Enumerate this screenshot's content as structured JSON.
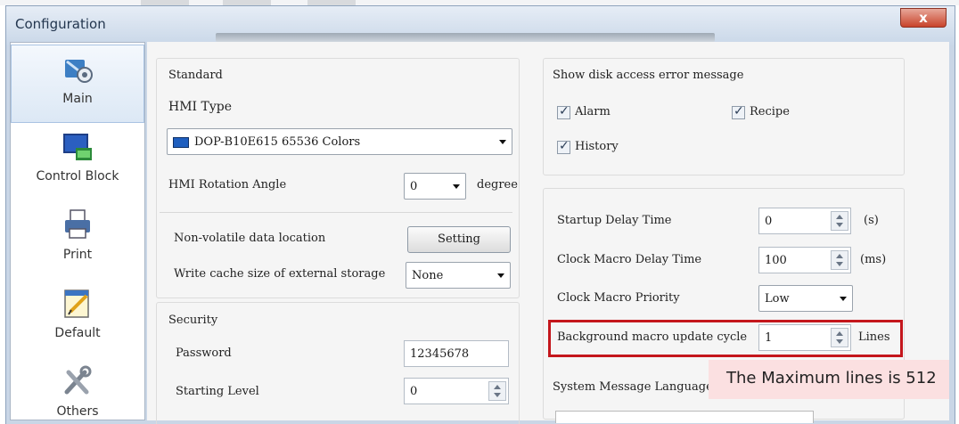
{
  "window": {
    "title": "Configuration",
    "close_label": "x"
  },
  "sidebar": {
    "items": [
      {
        "label": "Main",
        "icon": "main-config-icon",
        "selected": true
      },
      {
        "label": "Control Block",
        "icon": "control-block-icon",
        "selected": false
      },
      {
        "label": "Print",
        "icon": "printer-icon",
        "selected": false
      },
      {
        "label": "Default",
        "icon": "default-notepad-icon",
        "selected": false
      },
      {
        "label": "Others",
        "icon": "tools-icon",
        "selected": false
      }
    ]
  },
  "standard": {
    "title": "Standard",
    "hmi_type_label": "HMI Type",
    "hmi_type_value": "DOP-B10E615 65536 Colors",
    "rotation_label": "HMI Rotation Angle",
    "rotation_value": "0",
    "rotation_unit": "degree",
    "nonvolatile_label": "Non-volatile data location",
    "setting_button": "Setting",
    "write_cache_label": "Write cache size of external storage",
    "write_cache_value": "None"
  },
  "security": {
    "title": "Security",
    "password_label": "Password",
    "password_value": "12345678",
    "starting_level_label": "Starting Level",
    "starting_level_value": "0"
  },
  "disk_errors": {
    "title": "Show disk access error message",
    "checkboxes": [
      {
        "label": "Alarm",
        "checked": true
      },
      {
        "label": "Recipe",
        "checked": true
      },
      {
        "label": "History",
        "checked": true
      }
    ]
  },
  "timing": {
    "startup_delay_label": "Startup Delay Time",
    "startup_delay_value": "0",
    "startup_delay_unit": "(s)",
    "clock_macro_delay_label": "Clock Macro Delay Time",
    "clock_macro_delay_value": "100",
    "clock_macro_delay_unit": "(ms)",
    "clock_macro_priority_label": "Clock Macro Priority",
    "clock_macro_priority_value": "Low",
    "bg_macro_label": "Background macro update cycle",
    "bg_macro_value": "1",
    "bg_macro_unit": "Lines",
    "system_message_label": "System Message Language"
  },
  "tooltip": {
    "text": "The Maximum lines is 512"
  },
  "colors": {
    "highlight": "#c4161c",
    "tooltip_bg": "#fbe0e1",
    "window_frame": "#c9d6e6"
  }
}
